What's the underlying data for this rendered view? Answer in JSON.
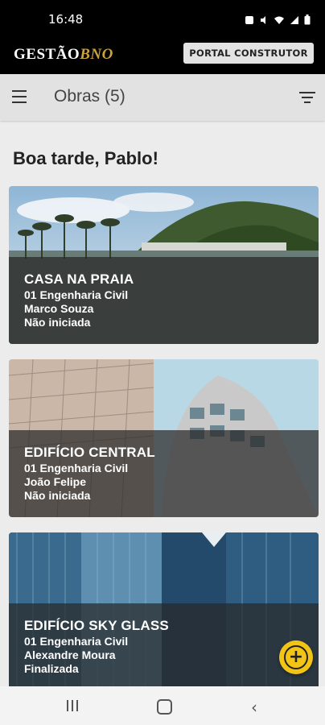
{
  "status_bar": {
    "time": "16:48"
  },
  "app_bar": {
    "logo_main": "GESTÃO",
    "logo_accent": "BNO",
    "portal_button": "PORTAL CONSTRUTOR"
  },
  "toolbar": {
    "title": "Obras (5)"
  },
  "greeting": "Boa tarde, Pablo!",
  "cards": [
    {
      "name": "CASA NA PRAIA",
      "company": "01 Engenharia Civil",
      "person": "Marco Souza",
      "status": "Não iniciada"
    },
    {
      "name": "EDIFÍCIO CENTRAL",
      "company": "01 Engenharia Civil",
      "person": "João Felipe",
      "status": "Não iniciada"
    },
    {
      "name": "EDIFÍCIO SKY GLASS",
      "company": "01 Engenharia Civil",
      "person": "Alexandre Moura",
      "status": "Finalizada"
    }
  ],
  "icons": {
    "menu": "menu-icon",
    "filter": "filter-icon",
    "add": "add-icon"
  },
  "colors": {
    "accent": "#f2c415",
    "logo_gold": "#c9a23c"
  }
}
